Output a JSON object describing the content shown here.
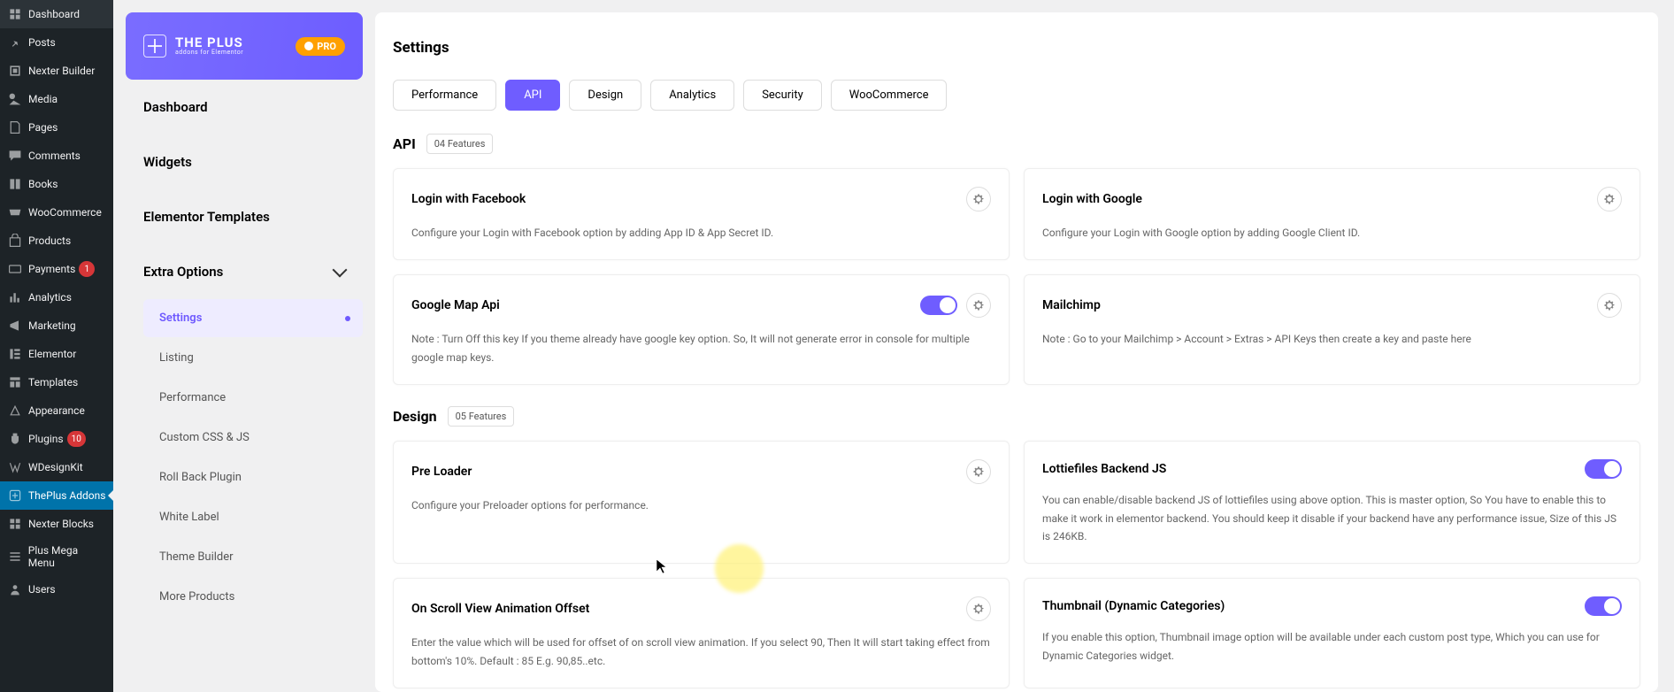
{
  "wp_sidebar": [
    {
      "icon": "dashboard",
      "label": "Dashboard"
    },
    {
      "icon": "pin",
      "label": "Posts"
    },
    {
      "icon": "nexter",
      "label": "Nexter Builder"
    },
    {
      "icon": "media",
      "label": "Media"
    },
    {
      "icon": "page",
      "label": "Pages"
    },
    {
      "icon": "comment",
      "label": "Comments"
    },
    {
      "icon": "book",
      "label": "Books"
    },
    {
      "icon": "woo",
      "label": "WooCommerce"
    },
    {
      "icon": "product",
      "label": "Products"
    },
    {
      "icon": "payment",
      "label": "Payments",
      "badge": "1"
    },
    {
      "icon": "analytics",
      "label": "Analytics"
    },
    {
      "icon": "marketing",
      "label": "Marketing"
    },
    {
      "icon": "elementor",
      "label": "Elementor"
    },
    {
      "icon": "template",
      "label": "Templates"
    },
    {
      "icon": "appearance",
      "label": "Appearance"
    },
    {
      "icon": "plugin",
      "label": "Plugins",
      "badge": "10"
    },
    {
      "icon": "wdesign",
      "label": "WDesignKit"
    },
    {
      "icon": "theplus",
      "label": "ThePlus Addons",
      "active": true
    },
    {
      "icon": "blocks",
      "label": "Nexter Blocks"
    },
    {
      "icon": "mega",
      "label": "Plus Mega Menu"
    },
    {
      "icon": "users",
      "label": "Users"
    }
  ],
  "plugin_header": {
    "title": "THE PLUS",
    "subtitle": "addons for Elementor",
    "pro": "PRO"
  },
  "pnav": {
    "items": [
      "Dashboard",
      "Widgets",
      "Elementor Templates"
    ],
    "extra_label": "Extra Options",
    "sub": [
      "Settings",
      "Listing",
      "Performance",
      "Custom CSS & JS",
      "Roll Back Plugin",
      "White Label",
      "Theme Builder",
      "More Products"
    ]
  },
  "main": {
    "title": "Settings",
    "tabs": [
      "Performance",
      "API",
      "Design",
      "Analytics",
      "Security",
      "WooCommerce"
    ],
    "active_tab": "API",
    "sections": [
      {
        "title": "API",
        "badge": "04 Features",
        "cards": [
          {
            "title": "Login with Facebook",
            "desc": "Configure your Login with Facebook option by adding App ID & App Secret ID.",
            "gear": true,
            "toggle": null
          },
          {
            "title": "Login with Google",
            "desc": "Configure your Login with Google option by adding Google Client ID.",
            "gear": true,
            "toggle": null
          },
          {
            "title": "Google Map Api",
            "desc": "Note : Turn Off this key If you theme already have google key option. So, It will not generate error in console for multiple google map keys.",
            "gear": true,
            "toggle": true
          },
          {
            "title": "Mailchimp",
            "desc": "Note : Go to your Mailchimp > Account > Extras > API Keys then create a key and paste here",
            "gear": true,
            "toggle": null
          }
        ]
      },
      {
        "title": "Design",
        "badge": "05 Features",
        "cards": [
          {
            "title": "Pre Loader",
            "desc": "Configure your Preloader options for performance.",
            "gear": true,
            "toggle": null
          },
          {
            "title": "Lottiefiles Backend JS",
            "desc": "You can enable/disable backend JS of lottiefiles using above option. This is master option, So You have to enable this to make it work in elementor backend. You should keep it disable if your backend have any performance issue, Size of this JS is 246KB.",
            "gear": false,
            "toggle": true
          },
          {
            "title": "On Scroll View Animation Offset",
            "desc": "Enter the value which will be used for offset of on scroll view animation. If you select 90, Then It will start taking effect from bottom's 10%. Default : 85 E.g. 90,85..etc.",
            "gear": true,
            "toggle": null
          },
          {
            "title": "Thumbnail (Dynamic Categories)",
            "desc": "If you enable this option, Thumbnail image option will be available under each custom post type, Which you can use for Dynamic Categories widget.",
            "gear": false,
            "toggle": true
          }
        ]
      }
    ]
  }
}
